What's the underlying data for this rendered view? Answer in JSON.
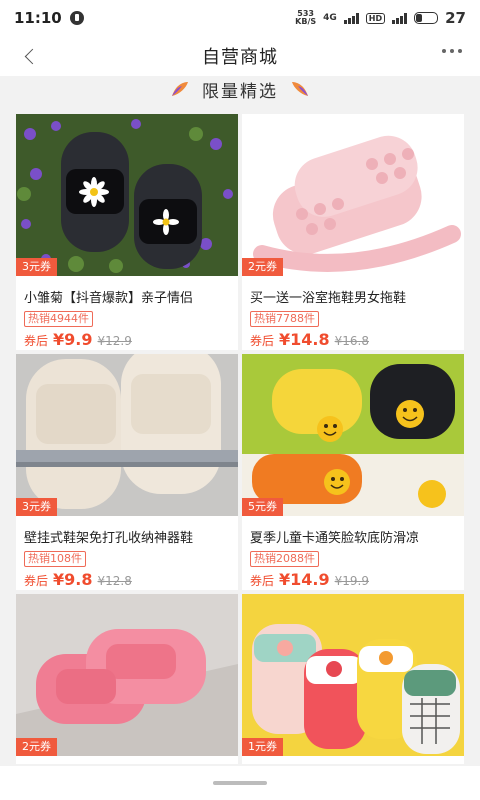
{
  "status_bar": {
    "time": "11:10",
    "speed_top": "533",
    "speed_bottom": "KB/S",
    "network": "4G",
    "hd": "HD",
    "battery": "27",
    "battery_level": 0.27
  },
  "header": {
    "title": "自营商城",
    "back_icon": "chevron-left-icon",
    "more_icon": "more-dots-icon"
  },
  "section": {
    "title": "限量精选"
  },
  "colors": {
    "accent": "#f04c2e",
    "coupon_bg": "#f05a3d",
    "badge": "#ef6b58"
  },
  "products": [
    {
      "coupon": "3元券",
      "title": "小雏菊【抖音爆款】亲子情侣",
      "sales": "热销4944件",
      "price_prefix": "券后",
      "price": "¥9.9",
      "original_price": "¥12.9"
    },
    {
      "coupon": "2元券",
      "title": "买一送一浴室拖鞋男女拖鞋",
      "sales": "热销7788件",
      "price_prefix": "券后",
      "price": "¥14.8",
      "original_price": "¥16.8"
    },
    {
      "coupon": "3元券",
      "title": "壁挂式鞋架免打孔收纳神器鞋",
      "sales": "热销108件",
      "price_prefix": "券后",
      "price": "¥9.8",
      "original_price": "¥12.8"
    },
    {
      "coupon": "5元券",
      "title": "夏季儿童卡通笑脸软底防滑凉",
      "sales": "热销2088件",
      "price_prefix": "券后",
      "price": "¥14.9",
      "original_price": "¥19.9"
    },
    {
      "coupon": "2元券"
    },
    {
      "coupon": "1元券"
    }
  ]
}
